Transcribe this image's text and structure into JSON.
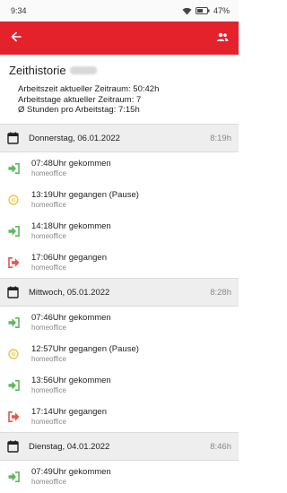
{
  "status_bar": {
    "time": "9:34",
    "battery": "47"
  },
  "app_bar": {
    "back_icon": "arrow-left-icon",
    "people_icon": "people-icon",
    "color": "#e3222c"
  },
  "summary": {
    "title": "Zeithistorie",
    "lines": [
      "Arbeitszeit aktueller Zeitraum: 50:42h",
      "Arbeitstage aktueller Zeitraum: 7",
      "Ø Stunden pro Arbeitstag: 7:15h"
    ]
  },
  "colors": {
    "in": "#5cb85c",
    "pause": "#e5c84a",
    "out": "#e2574c"
  },
  "days": [
    {
      "date": "Donnerstag, 06.01.2022",
      "total": "8:19h",
      "entries": [
        {
          "type": "in",
          "text": "07:48Uhr gekommen",
          "note": "homeoffice"
        },
        {
          "type": "pause",
          "text": "13:19Uhr gegangen (Pause)",
          "note": "homeoffice"
        },
        {
          "type": "in",
          "text": "14:18Uhr gekommen",
          "note": "homeoffice"
        },
        {
          "type": "out",
          "text": "17:06Uhr gegangen",
          "note": "homeoffice"
        }
      ]
    },
    {
      "date": "Mittwoch, 05.01.2022",
      "total": "8:28h",
      "entries": [
        {
          "type": "in",
          "text": "07:46Uhr gekommen",
          "note": "homeoffice"
        },
        {
          "type": "pause",
          "text": "12:57Uhr gegangen (Pause)",
          "note": "homeoffice"
        },
        {
          "type": "in",
          "text": "13:56Uhr gekommen",
          "note": "homeoffice"
        },
        {
          "type": "out",
          "text": "17:14Uhr gegangen",
          "note": "homeoffice"
        }
      ]
    },
    {
      "date": "Dienstag, 04.01.2022",
      "total": "8:46h",
      "entries": [
        {
          "type": "in",
          "text": "07:49Uhr gekommen",
          "note": "homeoffice"
        }
      ]
    }
  ]
}
